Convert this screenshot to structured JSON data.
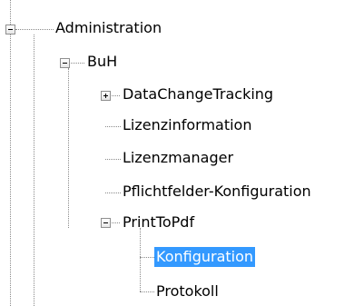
{
  "tree": {
    "nodes": [
      {
        "label": "Administration",
        "expanded": true,
        "selected": false
      },
      {
        "label": "BuH",
        "expanded": true,
        "selected": false
      },
      {
        "label": "DataChangeTracking",
        "expanded": false,
        "selected": false
      },
      {
        "label": "Lizenzinformation",
        "selected": false
      },
      {
        "label": "Lizenzmanager",
        "selected": false
      },
      {
        "label": "Pflichtfelder-Konfiguration",
        "selected": false
      },
      {
        "label": "PrintToPdf",
        "expanded": true,
        "selected": false
      },
      {
        "label": "Konfiguration",
        "selected": true
      },
      {
        "label": "Protokoll",
        "selected": false
      }
    ],
    "colors": {
      "selection_background": "#3399ff",
      "selection_text": "#ffffff",
      "connector_lines": "#8a8a8a"
    }
  }
}
